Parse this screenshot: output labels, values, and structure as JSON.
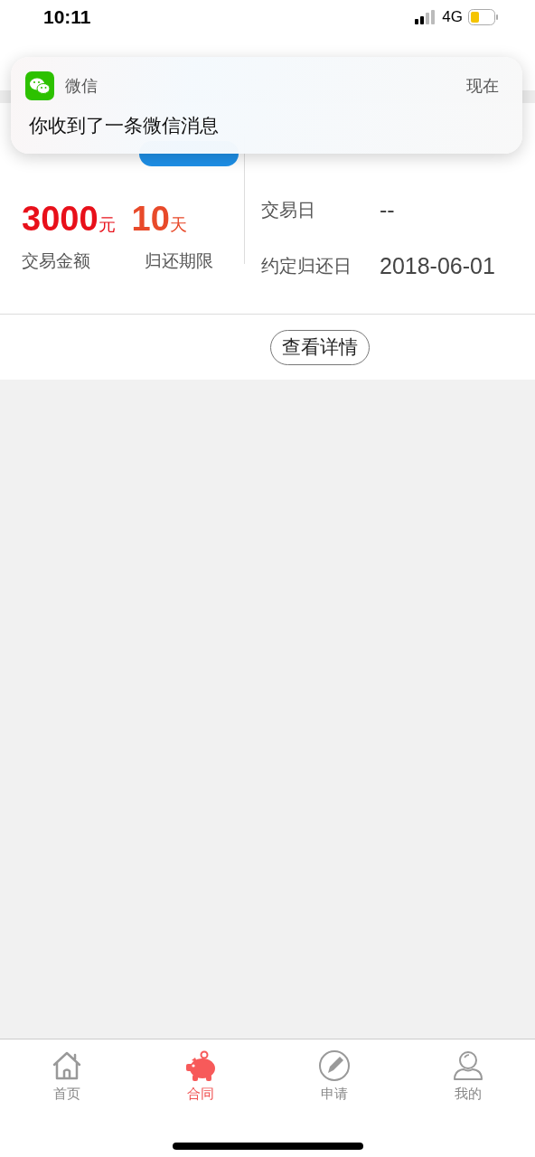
{
  "status_bar": {
    "time": "10:11",
    "network": "4G"
  },
  "bill": {
    "amount": "3000",
    "amount_unit": "元",
    "term": "10",
    "term_unit": "天",
    "amount_label": "交易金额",
    "term_label": "归还期限",
    "fields": [
      {
        "label": "交易日",
        "value": "--"
      },
      {
        "label": "约定归还日",
        "value": "2018-06-01"
      }
    ],
    "detail_button": "查看详情"
  },
  "bottom_nav": [
    {
      "label": "首页",
      "kind": "home",
      "selected": false
    },
    {
      "label": "合同",
      "kind": "piggy",
      "selected": true
    },
    {
      "label": "申请",
      "kind": "pencil",
      "selected": false
    },
    {
      "label": "我的",
      "kind": "person",
      "selected": false
    }
  ],
  "notification": {
    "app": "微信",
    "time": "现在",
    "message": "你收到了一条微信消息"
  }
}
